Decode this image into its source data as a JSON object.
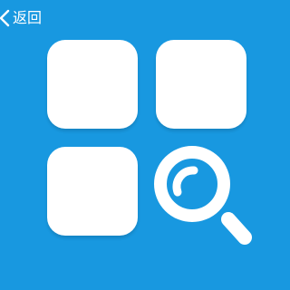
{
  "header": {
    "back_label": "返回",
    "back_icon": "chevron-left-icon"
  },
  "illustration": {
    "icon": "app-grid-search-icon",
    "tiles": 3,
    "magnifier_icon": "magnifier-icon"
  },
  "colors": {
    "background": "#1898e0",
    "foreground": "#ffffff"
  }
}
